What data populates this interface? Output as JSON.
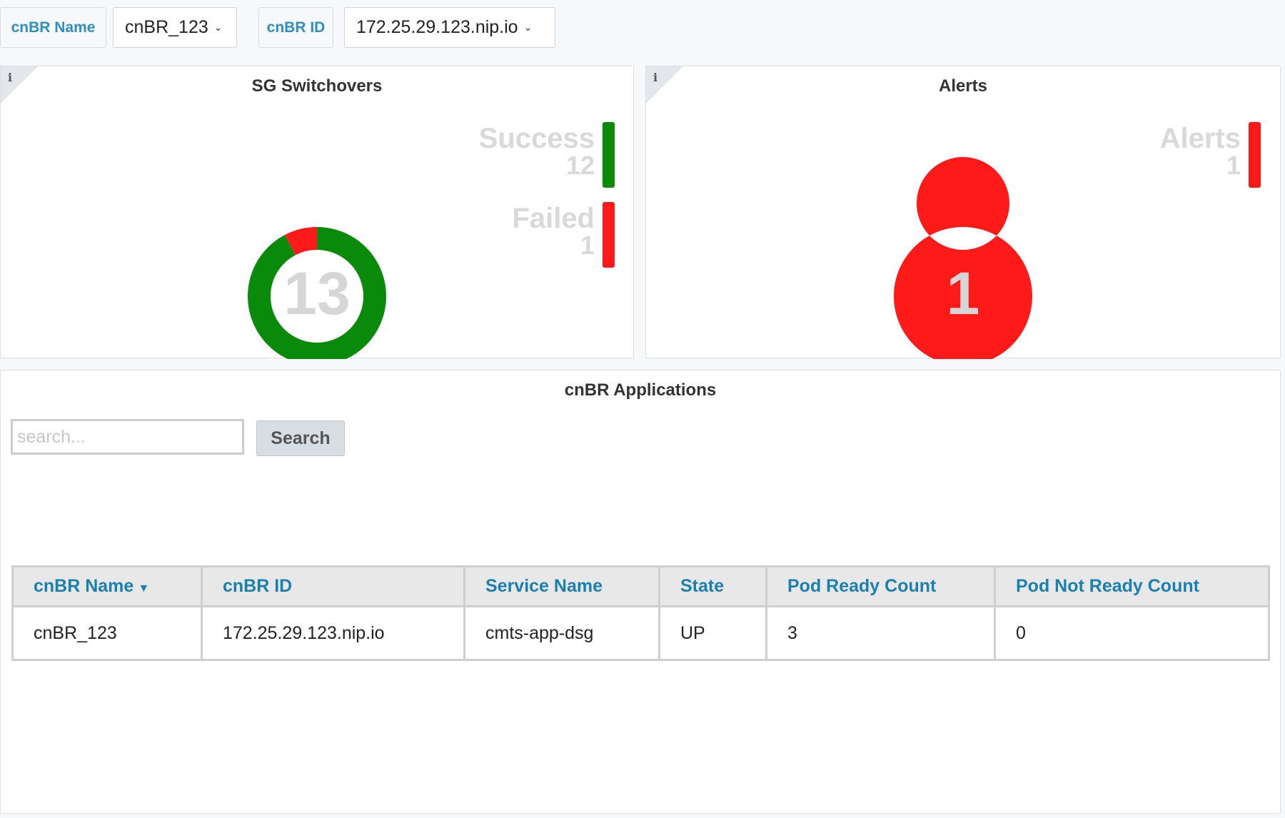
{
  "variables": {
    "name_label": "cnBR Name",
    "name_value": "cnBR_123",
    "id_label": "cnBR ID",
    "id_value": "172.25.29.123.nip.io"
  },
  "sg_panel": {
    "title": "SG Switchovers",
    "info_icon": "i",
    "total": "13",
    "legend": [
      {
        "label": "Success",
        "value": "12",
        "color": "#0a8a0a"
      },
      {
        "label": "Failed",
        "value": "1",
        "color": "#ff1a1a"
      }
    ]
  },
  "alerts_panel": {
    "title": "Alerts",
    "info_icon": "i",
    "total": "1",
    "legend": [
      {
        "label": "Alerts",
        "value": "1",
        "color": "#ff1a1a"
      }
    ]
  },
  "apps_panel": {
    "title": "cnBR Applications",
    "search_placeholder": "search...",
    "search_button": "Search",
    "columns": [
      "cnBR Name",
      "cnBR ID",
      "Service Name",
      "State",
      "Pod Ready Count",
      "Pod Not Ready Count"
    ],
    "sort_indicator": "▼",
    "rows": [
      [
        "cnBR_123",
        "172.25.29.123.nip.io",
        "cmts-app-dsg",
        "UP",
        "3",
        "0"
      ]
    ]
  }
}
